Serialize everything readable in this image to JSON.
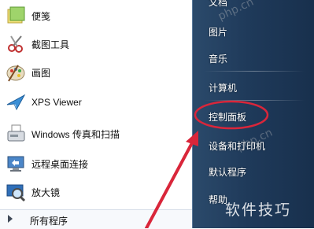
{
  "left_panel": {
    "programs": [
      {
        "label": "便笺",
        "icon": "sticky-notes-icon"
      },
      {
        "label": "截图工具",
        "icon": "snipping-tool-icon"
      },
      {
        "label": "画图",
        "icon": "paint-palette-icon"
      },
      {
        "label": "XPS Viewer",
        "icon": "xps-viewer-icon"
      },
      {
        "label": "Windows 传真和扫描",
        "icon": "fax-scanner-icon"
      },
      {
        "label": "远程桌面连接",
        "icon": "remote-desktop-icon"
      },
      {
        "label": "放大镜",
        "icon": "magnifier-icon"
      }
    ],
    "all_programs_label": "所有程序"
  },
  "right_panel": {
    "items": [
      {
        "label": "文档"
      },
      {
        "label": "图片"
      },
      {
        "label": "音乐"
      },
      {
        "label": "计算机"
      },
      {
        "label": "控制面板"
      },
      {
        "label": "设备和打印机"
      },
      {
        "label": "默认程序"
      },
      {
        "label": "帮助"
      }
    ],
    "highlighted_item": "控制面板"
  },
  "annotation": {
    "highlight_color": "#d9263a",
    "arrow_color": "#d9263a"
  },
  "watermarks": {
    "main": "软件技巧",
    "faint": "php.cn"
  }
}
